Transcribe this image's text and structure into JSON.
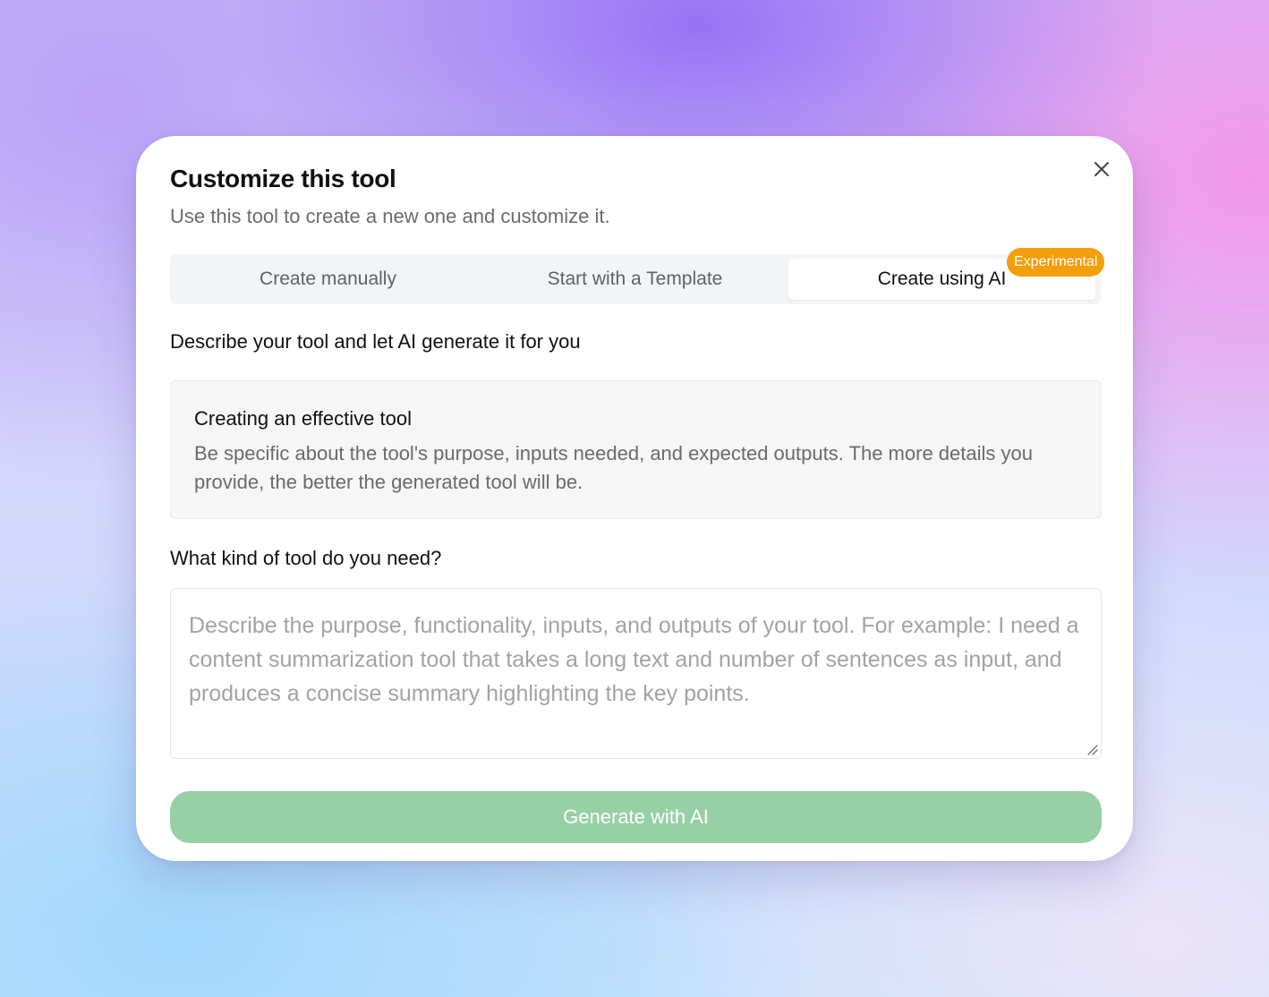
{
  "dialog": {
    "title": "Customize this tool",
    "subtitle": "Use this tool to create a new one and customize it.",
    "close_icon": "close-icon"
  },
  "tabs": [
    {
      "label": "Create manually",
      "active": false
    },
    {
      "label": "Start with a Template",
      "active": false
    },
    {
      "label": "Create using AI",
      "active": true,
      "badge": "Experimental"
    }
  ],
  "ai_section": {
    "heading": "Describe your tool and let AI generate it for you",
    "info": {
      "title": "Creating an effective tool",
      "text": "Be specific about the tool's purpose, inputs needed, and expected outputs. The more details you provide, the better the generated tool will be."
    },
    "prompt_label": "What kind of tool do you need?",
    "prompt_value": "",
    "prompt_placeholder": "Describe the purpose, functionality, inputs, and outputs of your tool. For example: I need a content summarization tool that takes a long text and number of sentences as input, and produces a concise summary highlighting the key points.",
    "generate_label": "Generate with AI"
  },
  "colors": {
    "badge": "#f59e0b",
    "generate_button": "#98d0a6"
  }
}
